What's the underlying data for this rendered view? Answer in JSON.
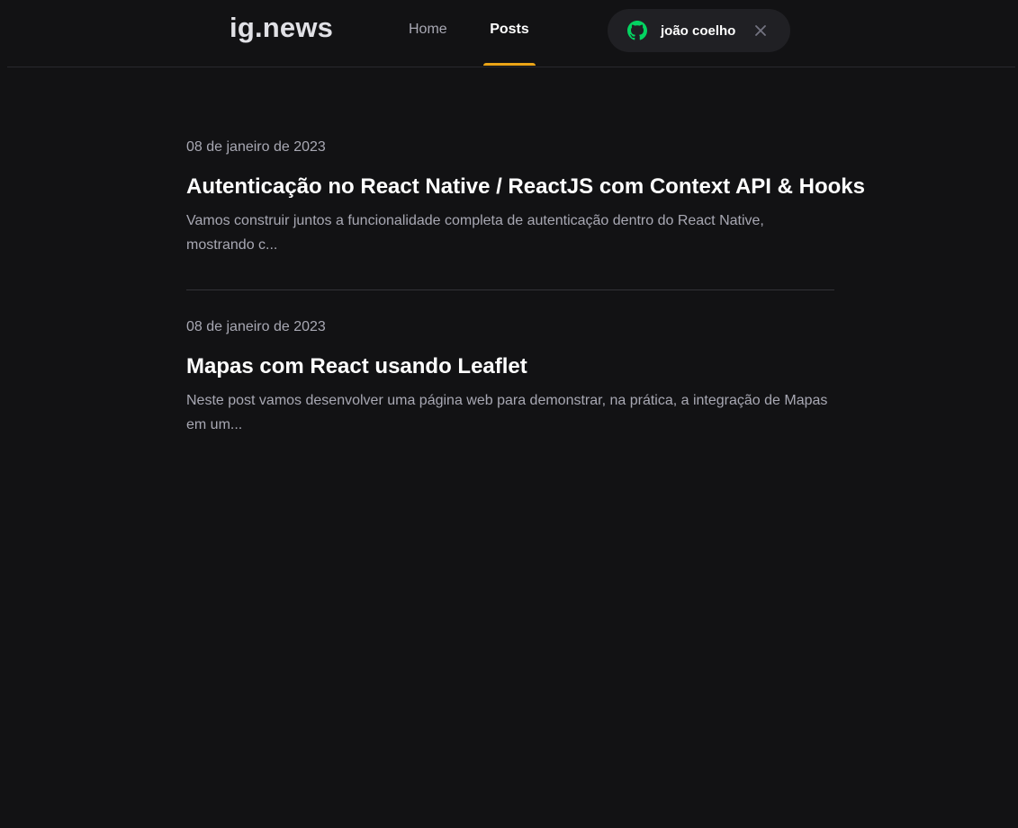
{
  "header": {
    "logo": "ig.news",
    "nav": [
      {
        "label": "Home",
        "active": false
      },
      {
        "label": "Posts",
        "active": true
      }
    ],
    "active_color": "#eba417",
    "signin": {
      "icon": "github-icon",
      "icon_color": "#04d361",
      "user_name": "joão coelho",
      "close_icon": "close-icon"
    }
  },
  "posts": [
    {
      "date": "08 de janeiro de 2023",
      "title": "Autenticação no React Native / ReactJS com Context API & Hooks",
      "excerpt": "Vamos construir juntos a funcionalidade completa de autenticação dentro do React Native, mostrando c..."
    },
    {
      "date": "08 de janeiro de 2023",
      "title": "Mapas com React usando Leaflet",
      "excerpt": "Neste post vamos desenvolver uma página web para demonstrar, na prática, a integração de Mapas em um..."
    }
  ]
}
